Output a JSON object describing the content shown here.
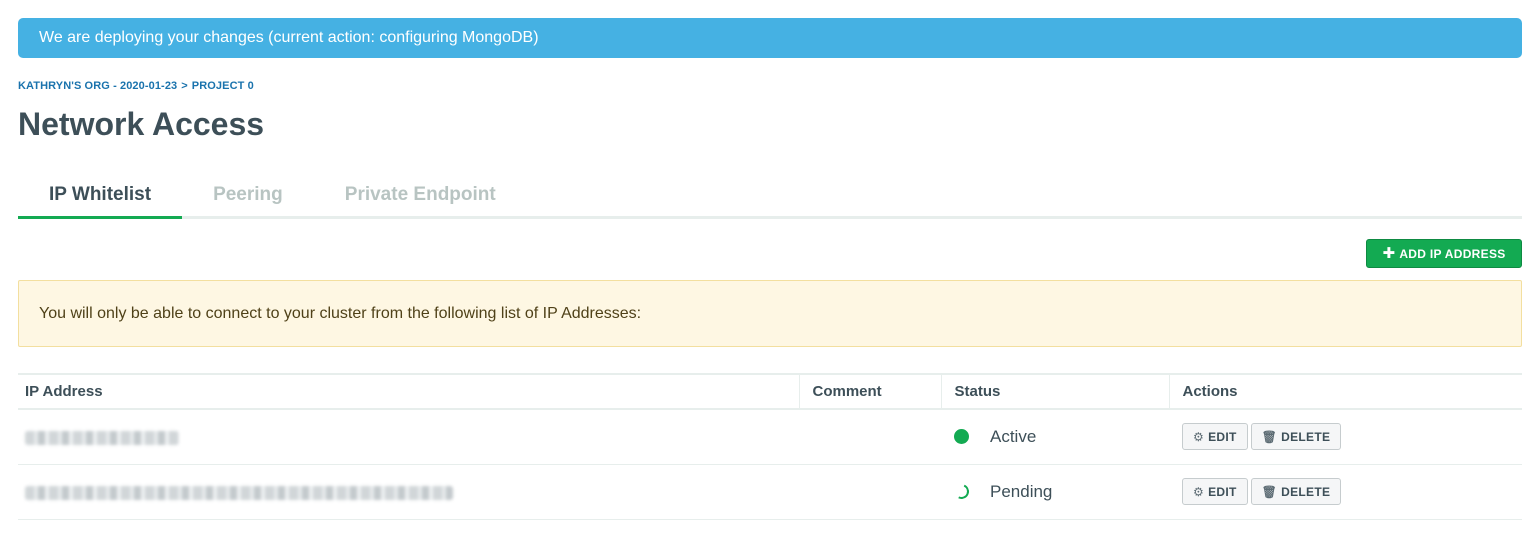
{
  "banner": {
    "text": "We are deploying your changes (current action: configuring MongoDB)"
  },
  "breadcrumb": {
    "org": "KATHRYN'S ORG - 2020-01-23",
    "separator": ">",
    "project": "PROJECT 0"
  },
  "page_title": "Network Access",
  "tabs": [
    {
      "label": "IP Whitelist",
      "active": true
    },
    {
      "label": "Peering",
      "active": false
    },
    {
      "label": "Private Endpoint",
      "active": false
    }
  ],
  "add_button": {
    "icon": "plus-icon",
    "label": "ADD IP ADDRESS"
  },
  "notice": {
    "text": "You will only be able to connect to your cluster from the following list of IP Addresses:"
  },
  "table": {
    "headers": {
      "ip": "IP Address",
      "comment": "Comment",
      "status": "Status",
      "actions": "Actions"
    },
    "rows": [
      {
        "ip_redacted": true,
        "comment": "",
        "status": "Active",
        "status_icon": "active-dot-icon"
      },
      {
        "ip_redacted": true,
        "comment": "",
        "status": "Pending",
        "status_icon": "pending-spinner-icon"
      }
    ],
    "edit_label": "EDIT",
    "delete_label": "DELETE"
  },
  "colors": {
    "banner": "#45b1e3",
    "accent_green": "#13aa52",
    "breadcrumb_link": "#1a73ad",
    "notice_bg": "#fef7e3"
  }
}
